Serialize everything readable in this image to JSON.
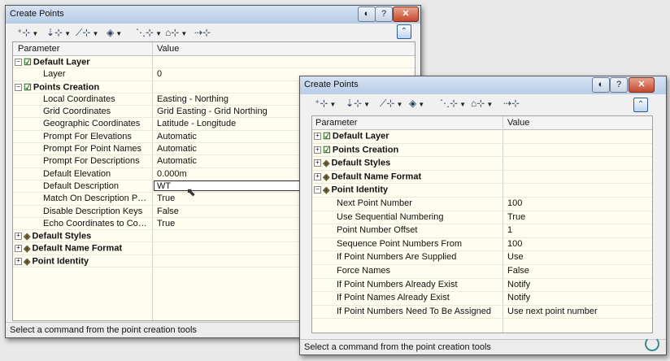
{
  "back_window": {
    "title": "Create Points",
    "help_label": "?",
    "close_label": "✕",
    "toolbar": [
      {
        "icon": "add-point-icon"
      },
      {
        "icon": "elevation-point-icon"
      },
      {
        "icon": "alignment-point-icon"
      },
      {
        "icon": "surface-point-icon"
      },
      {
        "icon": "interpolate-point-icon"
      },
      {
        "icon": "slope-point-icon"
      },
      {
        "icon": "convert-point-icon"
      }
    ],
    "header": {
      "param": "Parameter",
      "value": "Value"
    },
    "rows": [
      {
        "type": "cat",
        "name": "Default Layer",
        "exp": "⊟",
        "icon": "checklist-icon"
      },
      {
        "type": "item",
        "name": "Layer",
        "value": "0"
      },
      {
        "type": "cat",
        "name": "Points Creation",
        "exp": "⊟",
        "icon": "checklist-icon"
      },
      {
        "type": "item",
        "name": "Local Coordinates",
        "value": "Easting - Northing"
      },
      {
        "type": "item",
        "name": "Grid Coordinates",
        "value": "Grid Easting - Grid Northing"
      },
      {
        "type": "item",
        "name": "Geographic Coordinates",
        "value": "Latitude - Longitude"
      },
      {
        "type": "item",
        "name": "Prompt For Elevations",
        "value": "Automatic"
      },
      {
        "type": "item",
        "name": "Prompt For Point Names",
        "value": "Automatic"
      },
      {
        "type": "item",
        "name": "Prompt For Descriptions",
        "value": "Automatic"
      },
      {
        "type": "item",
        "name": "Default Elevation",
        "value": "0.000m"
      },
      {
        "type": "item",
        "name": "Default Description",
        "value": "WT",
        "editing": true
      },
      {
        "type": "item",
        "name": "Match On Description Paramet...",
        "value": "True"
      },
      {
        "type": "item",
        "name": "Disable Description Keys",
        "value": "False"
      },
      {
        "type": "item",
        "name": "Echo Coordinates to Comman...",
        "value": "True"
      },
      {
        "type": "cat",
        "name": "Default Styles",
        "exp": "⊞",
        "icon": "point-style-icon"
      },
      {
        "type": "cat",
        "name": "Default Name Format",
        "exp": "⊞",
        "icon": "point-style-icon"
      },
      {
        "type": "cat",
        "name": "Point Identity",
        "exp": "⊞",
        "icon": "point-style-icon"
      }
    ],
    "status": "Select a command from the point creation tools"
  },
  "front_window": {
    "title": "Create Points",
    "help_label": "?",
    "close_label": "✕",
    "toolbar": [
      {
        "icon": "add-point-icon"
      },
      {
        "icon": "elevation-point-icon"
      },
      {
        "icon": "alignment-point-icon"
      },
      {
        "icon": "surface-point-icon"
      },
      {
        "icon": "interpolate-point-icon"
      },
      {
        "icon": "slope-point-icon"
      },
      {
        "icon": "convert-point-icon"
      }
    ],
    "header": {
      "param": "Parameter",
      "value": "Value"
    },
    "rows": [
      {
        "type": "cat",
        "name": "Default Layer",
        "exp": "⊞",
        "icon": "checklist-icon"
      },
      {
        "type": "cat",
        "name": "Points Creation",
        "exp": "⊞",
        "icon": "checklist-icon"
      },
      {
        "type": "cat",
        "name": "Default Styles",
        "exp": "⊞",
        "icon": "point-style-icon"
      },
      {
        "type": "cat",
        "name": "Default Name Format",
        "exp": "⊞",
        "icon": "point-style-icon"
      },
      {
        "type": "cat",
        "name": "Point Identity",
        "exp": "⊟",
        "icon": "point-style-icon"
      },
      {
        "type": "item",
        "name": "Next Point Number",
        "value": "100"
      },
      {
        "type": "item",
        "name": "Use Sequential Numbering",
        "value": "True"
      },
      {
        "type": "item",
        "name": "Point Number Offset",
        "value": "1"
      },
      {
        "type": "item",
        "name": "Sequence Point Numbers From",
        "value": "100"
      },
      {
        "type": "item",
        "name": "If Point Numbers Are Supplied",
        "value": "Use"
      },
      {
        "type": "item",
        "name": "Force Names",
        "value": "False"
      },
      {
        "type": "item",
        "name": "If Point Numbers Already Exist",
        "value": "Notify"
      },
      {
        "type": "item",
        "name": "If Point Names Already Exist",
        "value": "Notify"
      },
      {
        "type": "item",
        "name": "If Point Numbers Need To Be Assigned",
        "value": "Use next point number"
      }
    ],
    "status": "Select a command from the point creation tools"
  }
}
